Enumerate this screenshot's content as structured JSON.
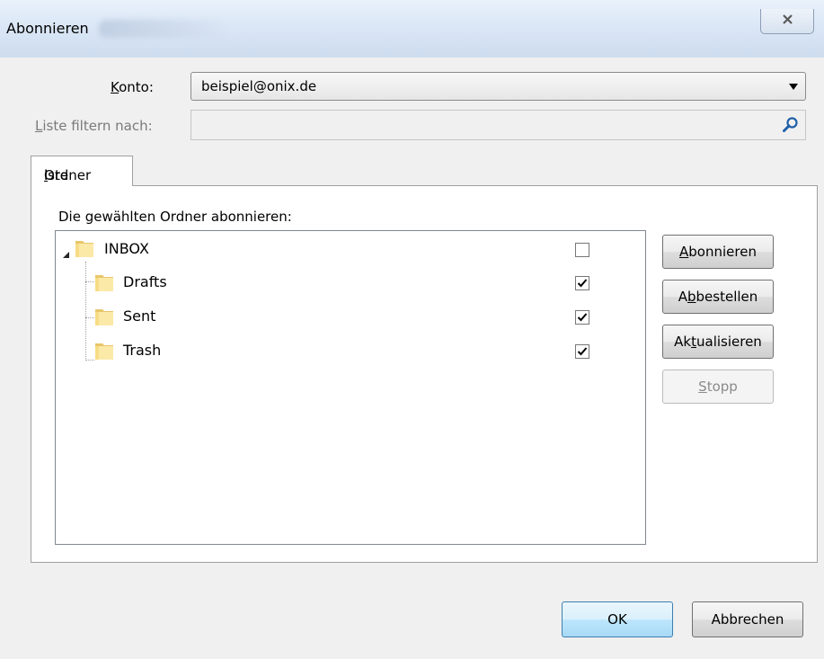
{
  "window": {
    "title": "Abonnieren",
    "close_icon": "close-icon"
  },
  "form": {
    "account_label_prefix": "",
    "account_label_mnemonic": "K",
    "account_label_rest": "onto:",
    "account_value": "beispiel@onix.de",
    "filter_label_mnemonic": "L",
    "filter_label_rest": "iste filtern nach:",
    "filter_value": "",
    "filter_icon": "search-icon"
  },
  "tab": {
    "label_before": "Ordner",
    "label_mnemonic": "l",
    "label_after": "iste"
  },
  "panel": {
    "heading": "Die gewählten Ordner abonnieren:"
  },
  "folders": [
    {
      "name": "INBOX",
      "subscribed": false,
      "expanded": true
    },
    {
      "name": "Drafts",
      "subscribed": true
    },
    {
      "name": "Sent",
      "subscribed": true
    },
    {
      "name": "Trash",
      "subscribed": true
    }
  ],
  "buttons": {
    "subscribe": {
      "mnemonic": "A",
      "rest": "bonnieren"
    },
    "unsubscribe": {
      "before": "A",
      "mnemonic": "b",
      "rest": "bestellen"
    },
    "refresh": {
      "before": "Ak",
      "mnemonic": "t",
      "rest": "ualisieren"
    },
    "stop": {
      "mnemonic": "S",
      "rest": "topp",
      "disabled": true
    },
    "ok": "OK",
    "cancel": "Abbrechen"
  }
}
